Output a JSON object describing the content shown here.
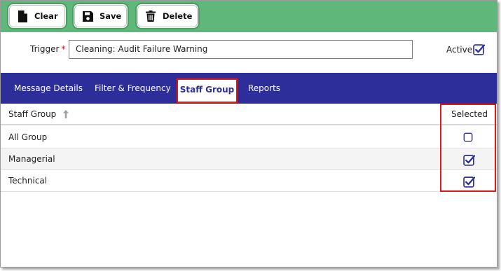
{
  "toolbar": {
    "clear_label": "Clear",
    "save_label": "Save",
    "delete_label": "Delete",
    "background": "#5fb87a"
  },
  "trigger": {
    "label": "Trigger",
    "required_mark": "*",
    "value": "Cleaning: Audit Failure Warning"
  },
  "active": {
    "label": "Active",
    "checked": true
  },
  "tabs": [
    {
      "label": "Message Details",
      "active": false
    },
    {
      "label": "Filter & Frequency",
      "active": false
    },
    {
      "label": "Staff Group",
      "active": true
    },
    {
      "label": "Reports",
      "active": false
    }
  ],
  "table": {
    "columns": [
      "Staff Group",
      "Selected"
    ],
    "sort_icon": "arrow-up-icon",
    "rows": [
      {
        "name": "All Group",
        "selected": false
      },
      {
        "name": "Managerial",
        "selected": true
      },
      {
        "name": "Technical",
        "selected": true
      }
    ]
  },
  "colors": {
    "tab_bar": "#2e2e9a",
    "highlight": "#e0161b",
    "required": "#d01515"
  }
}
